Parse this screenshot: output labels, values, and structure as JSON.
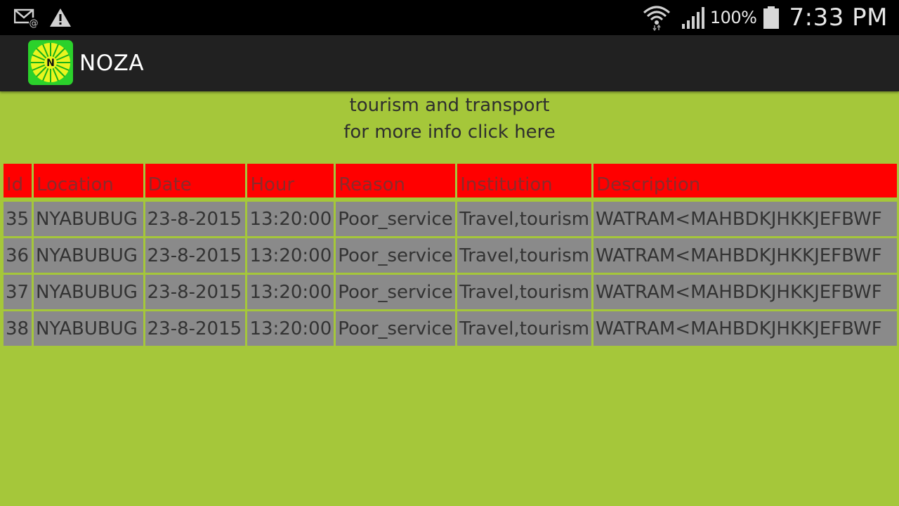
{
  "statusbar": {
    "battery_percent": "100%",
    "time": "7:33 PM",
    "left_icons": [
      "email-notification-icon",
      "warning-icon"
    ],
    "right_icons": [
      "wifi-icon",
      "signal-icon",
      "battery-icon"
    ]
  },
  "actionbar": {
    "title": "NOZA",
    "logo_letter": "N"
  },
  "header": {
    "title": "tourism and transport",
    "link": "for more info click here"
  },
  "table": {
    "columns": [
      "Id",
      "Location",
      "Date",
      "Hour",
      "Reason",
      "Institution",
      "Description"
    ],
    "rows": [
      [
        "35",
        "NYABUBUG",
        "23-8-2015",
        "13:20:00",
        "Poor_service",
        "Travel,tourism",
        "WATRAM<MAHBDKJHKKJEFBWF"
      ],
      [
        "36",
        "NYABUBUG",
        "23-8-2015",
        "13:20:00",
        "Poor_service",
        "Travel,tourism",
        "WATRAM<MAHBDKJHKKJEFBWF"
      ],
      [
        "37",
        "NYABUBUG",
        "23-8-2015",
        "13:20:00",
        "Poor_service",
        "Travel,tourism",
        "WATRAM<MAHBDKJHKKJEFBWF"
      ],
      [
        "38",
        "NYABUBUG",
        "23-8-2015",
        "13:20:00",
        "Poor_service",
        "Travel,tourism",
        "WATRAM<MAHBDKJHKKJEFBWF"
      ]
    ]
  },
  "colors": {
    "background": "#a5c73a",
    "header_cell": "#ff0000",
    "header_text": "#8a2b2b",
    "body_cell": "#8a8a8a",
    "body_text": "#333333",
    "actionbar": "#212121",
    "statusbar": "#000000"
  }
}
